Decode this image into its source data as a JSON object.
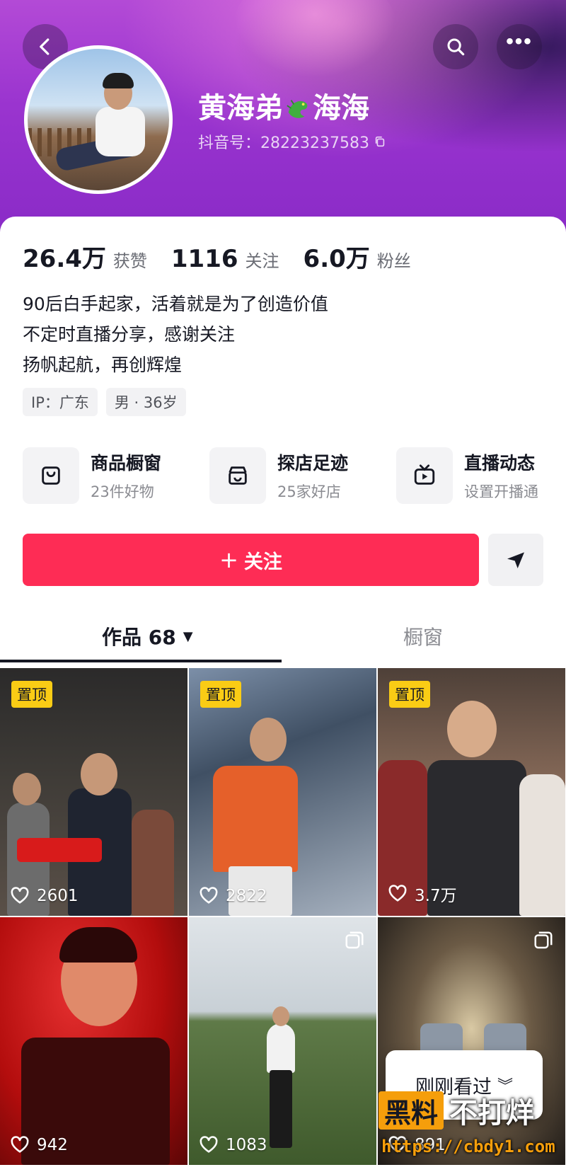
{
  "profile": {
    "name_part1": "黄海弟",
    "name_part2": "海海",
    "name_emoji_icon": "dragon-emoji-icon",
    "douyin_id": "抖音号：28223237583"
  },
  "stats": {
    "likes_value": "26.4万",
    "likes_label": "获赞",
    "following_value": "1116",
    "following_label": "关注",
    "followers_value": "6.0万",
    "followers_label": "粉丝"
  },
  "bio": [
    "90后白手起家，活着就是为了创造价值",
    "不定时直播分享，感谢关注",
    "扬帆起航，再创辉煌"
  ],
  "tags": [
    "IP：广东",
    "男 · 36岁"
  ],
  "services": [
    {
      "title": "商品橱窗",
      "subtitle": "23件好物",
      "icon": "bag-icon"
    },
    {
      "title": "探店足迹",
      "subtitle": "25家好店",
      "icon": "store-icon"
    },
    {
      "title": "直播动态",
      "subtitle": "设置开播通",
      "icon": "tv-icon"
    }
  ],
  "actions": {
    "follow_label": "关注",
    "share_icon": "send-icon"
  },
  "tabs": {
    "works": "作品 68",
    "shop": "橱窗"
  },
  "videos": [
    {
      "pinned_label": "置顶",
      "likes": "2601"
    },
    {
      "pinned_label": "置顶",
      "likes": "2822"
    },
    {
      "pinned_label": "置顶",
      "likes": "3.7万"
    },
    {
      "likes": "942"
    },
    {
      "likes": "1083"
    },
    {
      "likes": "891"
    }
  ],
  "recently_viewed": "刚刚看过",
  "watermark": {
    "badge": "黑料",
    "text": "不打烊",
    "url": "https://cbdy1.com"
  },
  "colors": {
    "accent": "#fe2c55",
    "pin_badge": "#facc15",
    "header_gradient": "#9a34cf"
  }
}
